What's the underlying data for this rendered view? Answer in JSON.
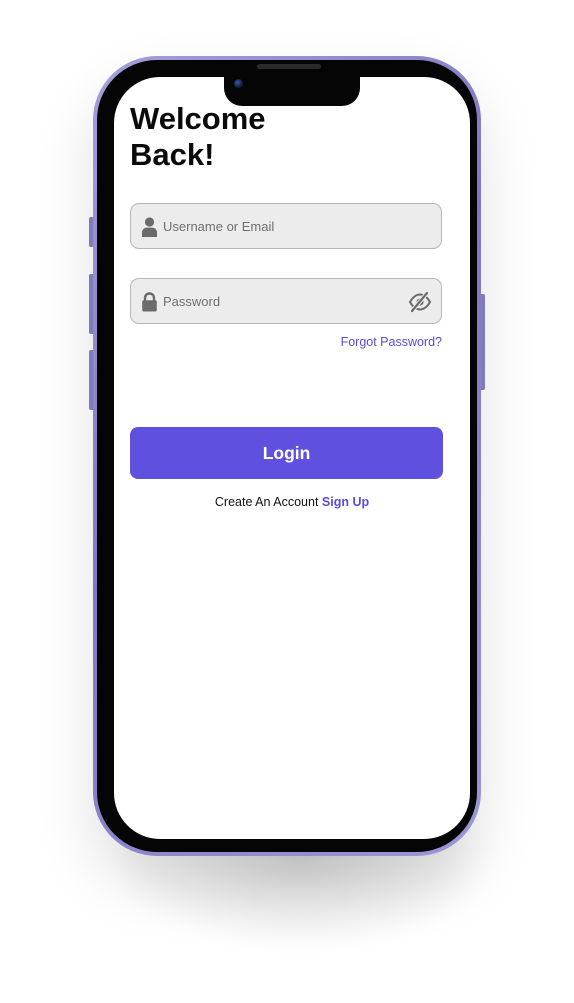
{
  "screen": {
    "title_line1": "Welcome",
    "title_line2": "Back!"
  },
  "username_field": {
    "placeholder": "Username or Email",
    "value": "",
    "icon": "user-icon"
  },
  "password_field": {
    "placeholder": "Password",
    "value": "",
    "icon": "lock-icon",
    "toggle_icon": "eye-off-icon"
  },
  "forgot_password_label": "Forgot Password?",
  "login_button_label": "Login",
  "signup": {
    "prompt": "Create An Account",
    "link_label": "Sign Up"
  },
  "colors": {
    "accent": "#6050e0",
    "link": "#5b4bd8",
    "phone_frame": "#8a83c4",
    "field_bg": "#ececec"
  }
}
